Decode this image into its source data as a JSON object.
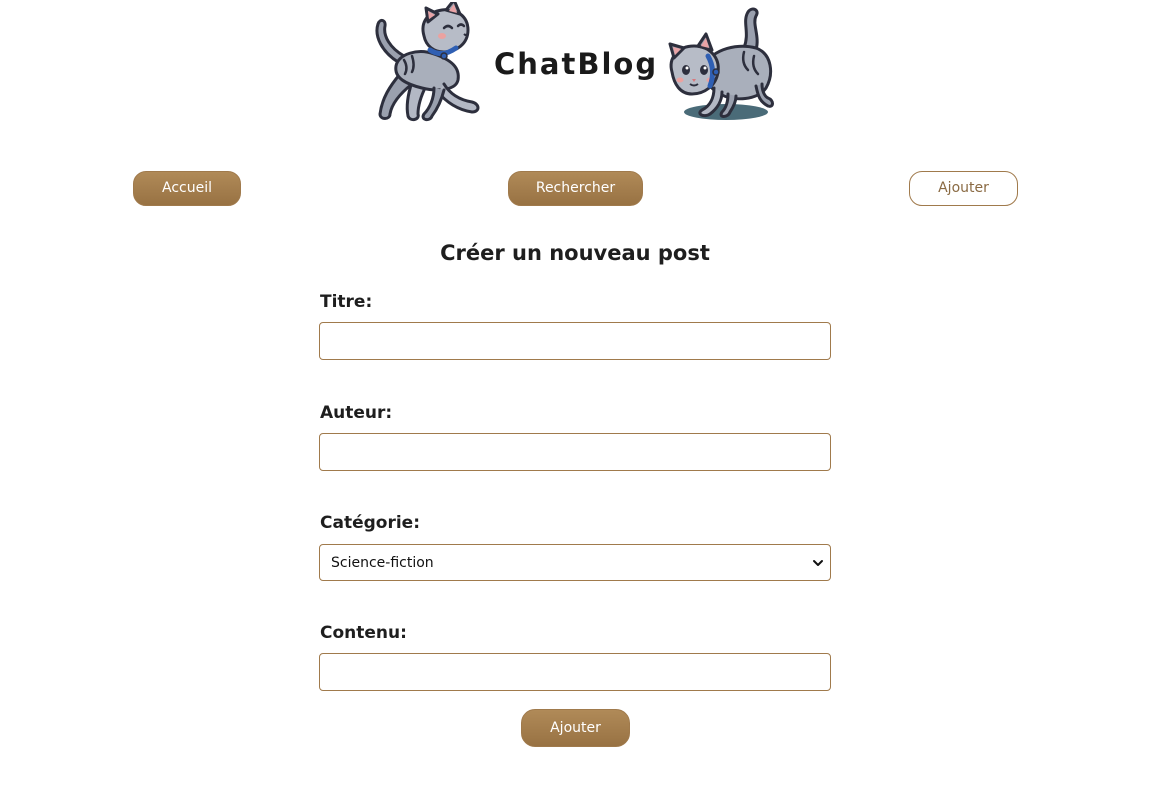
{
  "header": {
    "title": "ChatBlog",
    "left_logo_icon": "walking-cat-icon",
    "right_logo_icon": "crouching-cat-icon"
  },
  "nav": {
    "home_label": "Accueil",
    "search_label": "Rechercher",
    "add_label": "Ajouter"
  },
  "form": {
    "heading": "Créer un nouveau post",
    "title_label": "Titre:",
    "title_value": "",
    "author_label": "Auteur:",
    "author_value": "",
    "category_label": "Catégorie:",
    "category_selected": "Science-fiction",
    "content_label": "Contenu:",
    "content_value": "",
    "submit_label": "Ajouter"
  },
  "colors": {
    "accent": "#a07a4c",
    "button_fill": "#a27c4b",
    "text": "#1e1e1e",
    "background": "#ffffff"
  }
}
